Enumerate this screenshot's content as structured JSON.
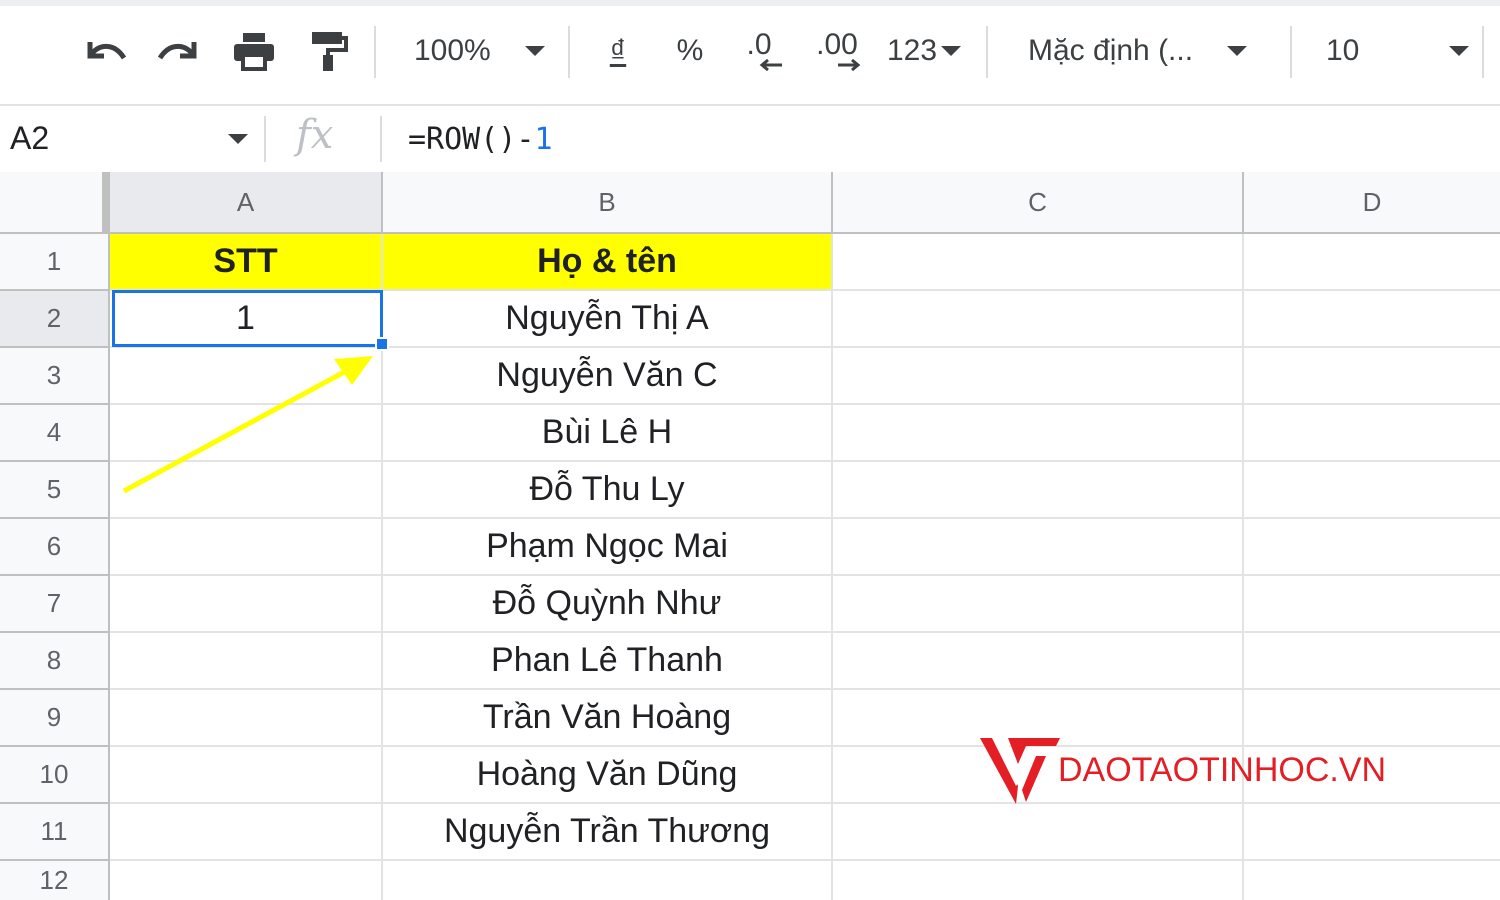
{
  "toolbar": {
    "zoom": "100%",
    "currency": "₫",
    "percent": "%",
    "decrease_decimal": ".0",
    "increase_decimal": ".00",
    "more_formats": "123",
    "font": "Mặc định (...",
    "font_size": "10"
  },
  "formula_bar": {
    "name_box": "A2",
    "formula_prefix": "=ROW()-",
    "formula_number": "1"
  },
  "columns": [
    "A",
    "B",
    "C",
    "D"
  ],
  "rows": [
    "1",
    "2",
    "3",
    "4",
    "5",
    "6",
    "7",
    "8",
    "9",
    "10",
    "11",
    "12"
  ],
  "sheet": {
    "header_stt": "STT",
    "header_name": "Họ & tên",
    "a2_value": "1",
    "names": [
      "Nguyễn Thị A",
      "Nguyễn Văn C",
      "Bùi Lê H",
      "Đỗ Thu Ly",
      "Phạm Ngọc Mai",
      "Đỗ Quỳnh Như",
      "Phan Lê Thanh",
      "Trần Văn Hoàng",
      "Hoàng Văn Dũng",
      "Nguyễn Trần Thương"
    ]
  },
  "watermark": {
    "text": "DAOTAOTINHOC.VN"
  },
  "colors": {
    "header_fill": "#ffff00",
    "selection": "#1a73e8",
    "annotation_arrow": "#ffff00",
    "brand": "#e31e24"
  }
}
